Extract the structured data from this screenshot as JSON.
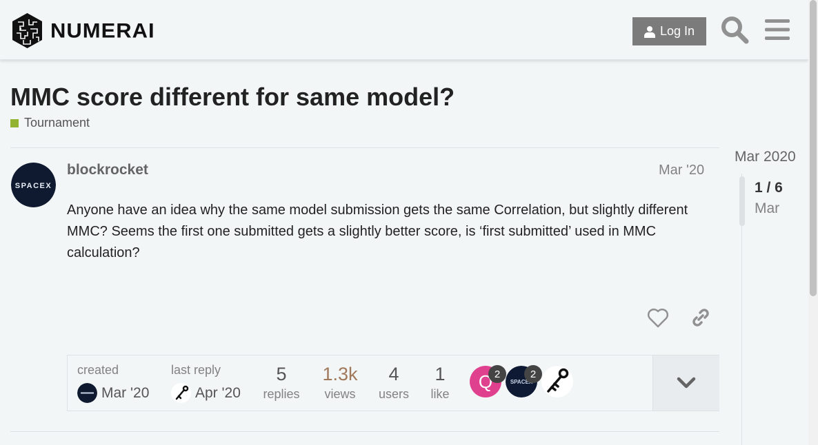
{
  "header": {
    "brand": "NUMERAI",
    "login_label": "Log In",
    "icons": [
      "numerai-logo-icon",
      "user-icon",
      "search-icon",
      "hamburger-menu-icon"
    ]
  },
  "topic": {
    "title": "MMC score different for same model?",
    "category": "Tournament",
    "category_color": "#92b330"
  },
  "post": {
    "username": "blockrocket",
    "date": "Mar '20",
    "body": "Anyone have an idea why the same model submission gets the same Correlation, but slightly different MMC? Seems the first one submitted gets a slightly better score, is ‘first submitted’ used in MMC calculation?",
    "avatar_text": "SPACEX"
  },
  "topic_map": {
    "created_label": "created",
    "created_date": "Mar '20",
    "last_reply_label": "last reply",
    "last_reply_date": "Apr '20",
    "replies_num": "5",
    "replies_label": "replies",
    "views_num": "1.3k",
    "views_label": "views",
    "views_color": "#a0785a",
    "users_num": "4",
    "users_label": "users",
    "likes_num": "1",
    "likes_label": "like",
    "participants": [
      {
        "initial": "Q",
        "count": "2",
        "color": "#e0418f"
      },
      {
        "initial": "SPACEX",
        "count": "2",
        "color": "#0e1a33"
      },
      {
        "initial": "",
        "count": "",
        "color": "#ffffff"
      }
    ]
  },
  "timeline": {
    "start": "Mar 2020",
    "position": "1 / 6",
    "current_date": "Mar"
  }
}
